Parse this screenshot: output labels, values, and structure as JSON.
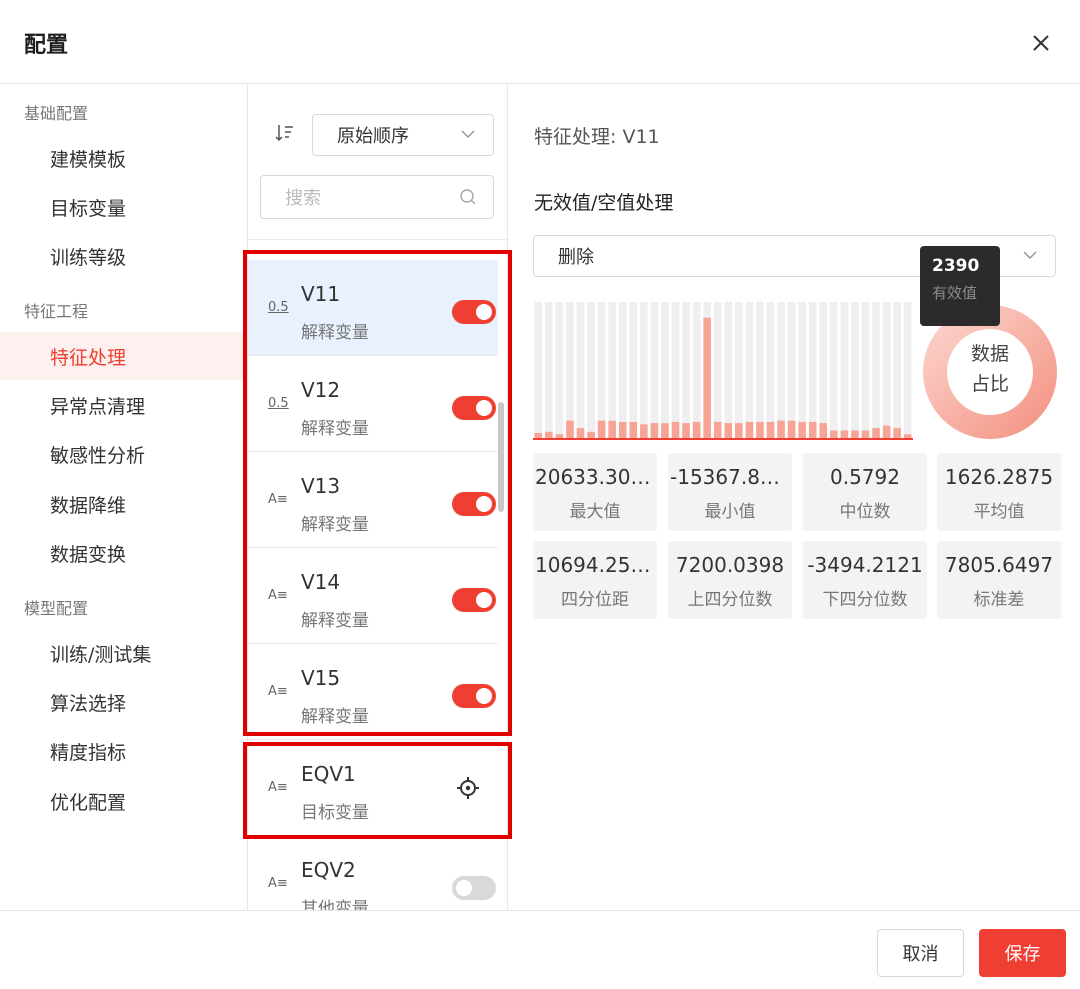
{
  "dialog": {
    "title": "配置",
    "cancel_label": "取消",
    "save_label": "保存"
  },
  "nav": {
    "groups": [
      "基础配置",
      "特征工程",
      "模型配置"
    ],
    "items": [
      "建模模板",
      "目标变量",
      "训练等级",
      "特征处理",
      "异常点清理",
      "敏感性分析",
      "数据降维",
      "数据变换",
      "训练/测试集",
      "算法选择",
      "精度指标",
      "优化配置"
    ],
    "active": "特征处理"
  },
  "list": {
    "sort_value": "原始顺序",
    "search_placeholder": "搜索",
    "items": [
      {
        "type": "0.5",
        "name": "V11",
        "role": "解释变量",
        "enabled": true
      },
      {
        "type": "A≡",
        "name": "V12",
        "role": "解释变量",
        "enabled": true
      },
      {
        "type": "A≡",
        "name": "V13",
        "role": "解释变量",
        "enabled": true
      },
      {
        "type": "A≡",
        "name": "V14",
        "role": "解释变量",
        "enabled": true
      },
      {
        "type": "A≡",
        "name": "V15",
        "role": "解释变量",
        "enabled": true
      },
      {
        "type": "A≡",
        "name": "EQV1",
        "role": "目标变量",
        "enabled": null
      },
      {
        "type": "A≡",
        "name": "EQV2",
        "role": "其他变量",
        "enabled": false
      }
    ]
  },
  "panel": {
    "feature_title": "特征处理: V11",
    "section_title": "无效值/空值处理",
    "handling_value": "删除",
    "tooltip_value": "2390",
    "tooltip_label": "有效值",
    "donut_label_1": "数据",
    "donut_label_2": "占比",
    "stats": [
      {
        "value": "20633.3060",
        "label": "最大值"
      },
      {
        "value": "-15367.82…",
        "label": "最小值"
      },
      {
        "value": "0.5792",
        "label": "中位数"
      },
      {
        "value": "1626.2875",
        "label": "平均值"
      },
      {
        "value": "10694.2518",
        "label": "四分位距"
      },
      {
        "value": "7200.0398",
        "label": "上四分位数"
      },
      {
        "value": "-3494.2121",
        "label": "下四分位数"
      },
      {
        "value": "7805.6497",
        "label": "标准差"
      }
    ],
    "histogram_relative_heights": [
      0.04,
      0.05,
      0.03,
      0.14,
      0.08,
      0.05,
      0.14,
      0.14,
      0.13,
      0.13,
      0.11,
      0.12,
      0.12,
      0.13,
      0.12,
      0.13,
      0.97,
      0.13,
      0.12,
      0.12,
      0.13,
      0.13,
      0.13,
      0.14,
      0.14,
      0.13,
      0.13,
      0.12,
      0.06,
      0.06,
      0.06,
      0.06,
      0.08,
      0.1,
      0.08,
      0.03
    ],
    "colors": {
      "accent": "#ee3f32",
      "bar_bg": "#efefef",
      "bar": "#f7a497"
    }
  }
}
